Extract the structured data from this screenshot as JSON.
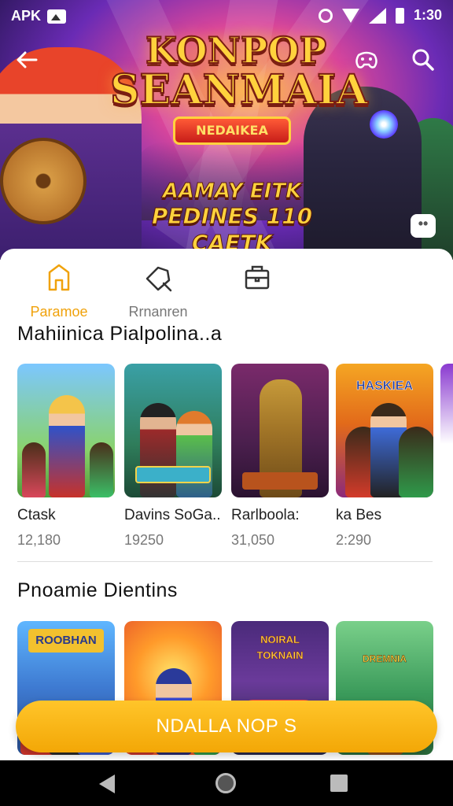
{
  "status_bar": {
    "carrier": "APK",
    "time": "1:30"
  },
  "hero": {
    "title_line1": "KONPOP",
    "title_line2": "SEANMAIA",
    "badge": "NEDAIKEA",
    "subtitle_line1": "AAMAY EITK",
    "subtitle_line2": "PEDINES 110 CAETK",
    "more_label": "••"
  },
  "tabs": [
    {
      "label": "Paramoe",
      "icon": "home-icon",
      "active": true
    },
    {
      "label": "Rrnanren",
      "icon": "tag-icon",
      "active": false
    },
    {
      "label": "",
      "icon": "store-icon",
      "active": false
    }
  ],
  "section1": {
    "title": "Mahiinica  Pialpolina..a",
    "cards": [
      {
        "name": "Ctask",
        "count": "12,180"
      },
      {
        "name": "Davins SoGa..",
        "count": "19250"
      },
      {
        "name": "Rarlboola:",
        "count": "31,050"
      },
      {
        "name": "ka Bes",
        "count": "2:290"
      }
    ],
    "thumb_texts": [
      "",
      "",
      "",
      "HASKIEA"
    ]
  },
  "section2": {
    "title": "Pnoamie Dientins",
    "thumb_texts": [
      "ROOBHAN",
      "",
      "NOIRAL TOKNAIN",
      "DREMNIA"
    ]
  },
  "cta": {
    "label": "NDALLA NOP S"
  },
  "colors": {
    "accent": "#f3a706",
    "tab_active": "#f0a20b"
  }
}
